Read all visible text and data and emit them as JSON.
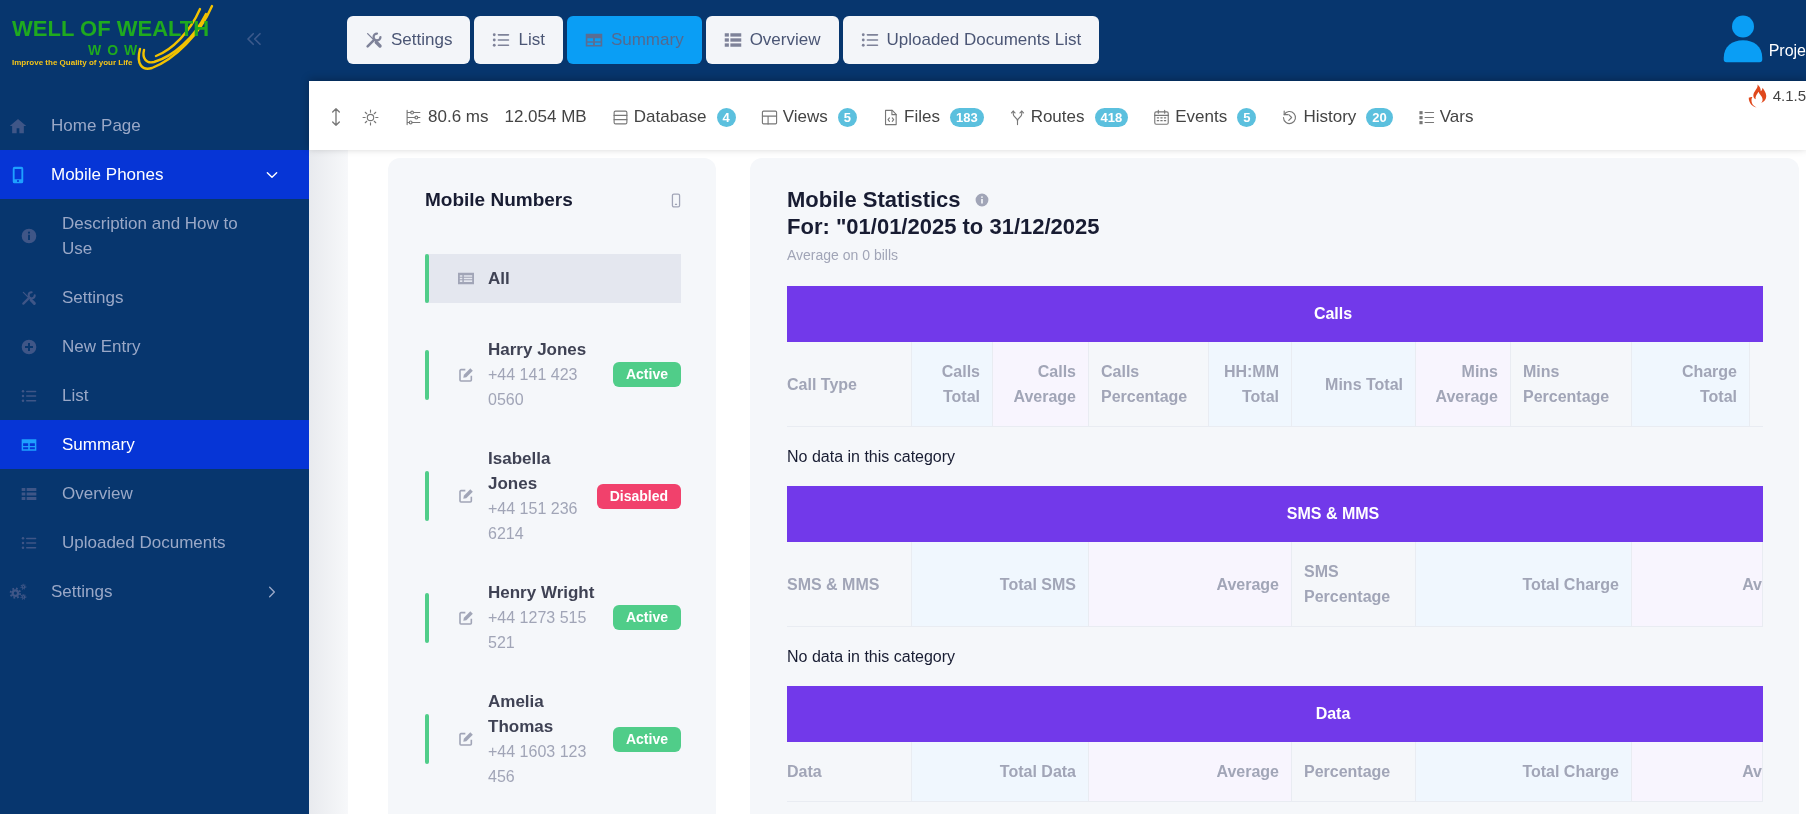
{
  "sidebar": {
    "logo": {
      "title": "WELL OF WEALTH",
      "wordmark": "WOW",
      "tagline": "Improve the Quality of your Life"
    },
    "items": [
      {
        "label": "Home Page",
        "kind": "link",
        "selected": false
      },
      {
        "label": "Mobile Phones",
        "kind": "group",
        "selected": true,
        "expanded": true,
        "children": [
          {
            "label": "Description and How to Use",
            "selected": false
          },
          {
            "label": "Settings",
            "selected": false
          },
          {
            "label": "New Entry",
            "selected": false
          },
          {
            "label": "List",
            "selected": false
          },
          {
            "label": "Summary",
            "selected": true
          },
          {
            "label": "Overview",
            "selected": false
          },
          {
            "label": "Uploaded Documents",
            "selected": false
          }
        ]
      },
      {
        "label": "Settings",
        "kind": "group",
        "selected": false,
        "expanded": false
      }
    ]
  },
  "tabs": [
    {
      "label": "Settings",
      "selected": false
    },
    {
      "label": "List",
      "selected": false
    },
    {
      "label": "Summary",
      "selected": true
    },
    {
      "label": "Overview",
      "selected": false
    },
    {
      "label": "Uploaded Documents List",
      "selected": false
    }
  ],
  "user": {
    "name": "Proje"
  },
  "debug_toolbar": {
    "timing": "80.6 ms",
    "memory": "12.054 MB",
    "items": [
      {
        "label": "Database",
        "count": "4"
      },
      {
        "label": "Views",
        "count": "5"
      },
      {
        "label": "Files",
        "count": "183"
      },
      {
        "label": "Routes",
        "count": "418"
      },
      {
        "label": "Events",
        "count": "5"
      },
      {
        "label": "History",
        "count": "20"
      },
      {
        "label": "Vars"
      }
    ],
    "version": "4.1.5"
  },
  "mobile_numbers": {
    "title": "Mobile Numbers",
    "items": [
      {
        "kind": "all",
        "name": "All",
        "selected": true
      },
      {
        "kind": "contact",
        "name": "Harry Jones",
        "phone": "+44 141 423 0560",
        "status": "Active",
        "active": true,
        "selected": false
      },
      {
        "kind": "contact",
        "name": "Isabella Jones",
        "phone": "+44 151 236 6214",
        "status": "Disabled",
        "active": false,
        "selected": false
      },
      {
        "kind": "contact",
        "name": "Henry Wright",
        "phone": "+44 1273 515 521",
        "status": "Active",
        "active": true,
        "selected": false
      },
      {
        "kind": "contact",
        "name": "Amelia Thomas",
        "phone": "+44 1603 123 456",
        "status": "Active",
        "active": true,
        "selected": false
      }
    ]
  },
  "statistics": {
    "title": "Mobile Statistics",
    "period": "For: \"01/01/2025 to 31/12/2025",
    "note": "Average on 0 bills",
    "tables": [
      {
        "title": "Calls",
        "columns": [
          {
            "label": "Call Type",
            "kind": "label"
          },
          {
            "label": "Calls Total",
            "kind": "total"
          },
          {
            "label": "Calls Average",
            "kind": "average"
          },
          {
            "label": "Calls Percentage",
            "kind": "percentage"
          },
          {
            "label": "HH:MM Total",
            "kind": "total"
          },
          {
            "label": "Mins Total",
            "kind": "total"
          },
          {
            "label": "Mins Average",
            "kind": "average"
          },
          {
            "label": "Mins Percentage",
            "kind": "percentage"
          },
          {
            "label": "Charge Total",
            "kind": "total"
          }
        ],
        "empty_text": "No data in this category"
      },
      {
        "title": "SMS & MMS",
        "columns": [
          {
            "label": "SMS & MMS",
            "kind": "label"
          },
          {
            "label": "Total SMS",
            "kind": "total"
          },
          {
            "label": "Average",
            "kind": "average"
          },
          {
            "label": "SMS Percentage",
            "kind": "percentage"
          },
          {
            "label": "Total Charge",
            "kind": "total"
          },
          {
            "label": "Av",
            "kind": "average"
          }
        ],
        "empty_text": "No data in this category"
      },
      {
        "title": "Data",
        "columns": [
          {
            "label": "Data",
            "kind": "label"
          },
          {
            "label": "Total Data",
            "kind": "total"
          },
          {
            "label": "Average",
            "kind": "average"
          },
          {
            "label": "Percentage",
            "kind": "percentage"
          },
          {
            "label": "Total Charge",
            "kind": "total"
          },
          {
            "label": "Av",
            "kind": "average"
          }
        ]
      }
    ]
  }
}
